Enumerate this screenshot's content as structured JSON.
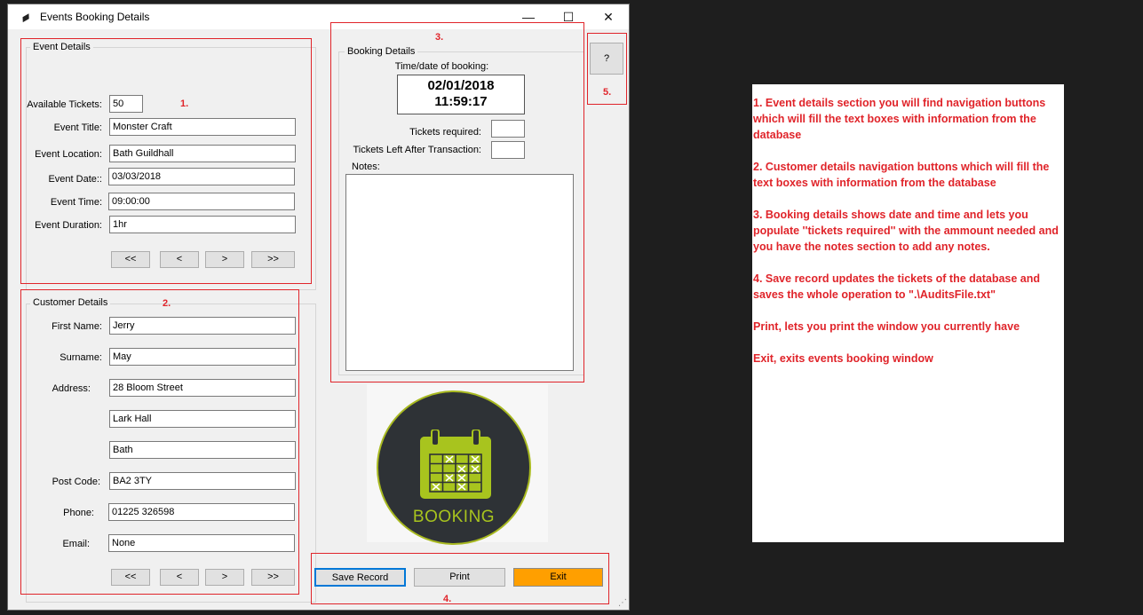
{
  "window": {
    "title": "Events Booking Details",
    "icon": "ticket-icon",
    "controls": {
      "minimize": "—",
      "maximize": "☐",
      "close": "✕"
    }
  },
  "event_details": {
    "group_label": "Event Details",
    "marker": "1.",
    "available_tickets_label": "Available Tickets:",
    "available_tickets": "50",
    "title_label": "Event Title:",
    "title": "Monster Craft",
    "location_label": "Event Location:",
    "location": "Bath Guildhall",
    "date_label": "Event Date::",
    "date": "03/03/2018",
    "time_label": "Event Time:",
    "time": "09:00:00",
    "duration_label": "Event Duration:",
    "duration": "1hr",
    "nav": {
      "first": "<<",
      "prev": "<",
      "next": ">",
      "last": ">>"
    }
  },
  "customer_details": {
    "group_label": "Customer Details",
    "marker": "2.",
    "first_name_label": "First Name:",
    "first_name": "Jerry",
    "surname_label": "Surname:",
    "surname": "May",
    "address_label": "Address:",
    "address1": "28 Bloom Street",
    "address2": "Lark Hall",
    "address3": "Bath",
    "postcode_label": "Post Code:",
    "postcode": "BA2 3TY",
    "phone_label": "Phone:",
    "phone": "01225 326598",
    "email_label": "Email:",
    "email": "None",
    "nav": {
      "first": "<<",
      "prev": "<",
      "next": ">",
      "last": ">>"
    }
  },
  "booking_details": {
    "group_label": "Booking Details",
    "marker": "3.",
    "time_date_label": "Time/date of booking:",
    "date": "02/01/2018",
    "time": "11:59:17",
    "tickets_required_label": "Tickets required:",
    "tickets_required": "",
    "tickets_left_label": "Tickets Left After Transaction:",
    "tickets_left": "",
    "notes_label": "Notes:",
    "notes": ""
  },
  "logo": {
    "text": "BOOKING",
    "icon": "calendar-icon"
  },
  "actions": {
    "marker": "4.",
    "save": "Save Record",
    "print": "Print",
    "exit": "Exit"
  },
  "help": {
    "label": "?",
    "marker": "5."
  },
  "colors": {
    "annotation_red": "#e0242a",
    "exit_orange": "#ff9f00",
    "logo_green": "#a8c41e",
    "logo_dark": "#2e3236"
  },
  "annotations": [
    "1. Event details section you will find navigation buttons which will fill the text boxes with information from the database",
    "2. Customer details navigation buttons which will fill the text boxes with information from the database",
    "3. Booking details shows date and time and lets you populate ''tickets required'' with the ammount needed and you have the notes section to add any notes.",
    "4. Save record updates the tickets of the database and saves the whole operation to \".\\AuditsFile.txt\"",
    "Print, lets you print the window you currently have",
    "Exit, exits events booking window"
  ]
}
